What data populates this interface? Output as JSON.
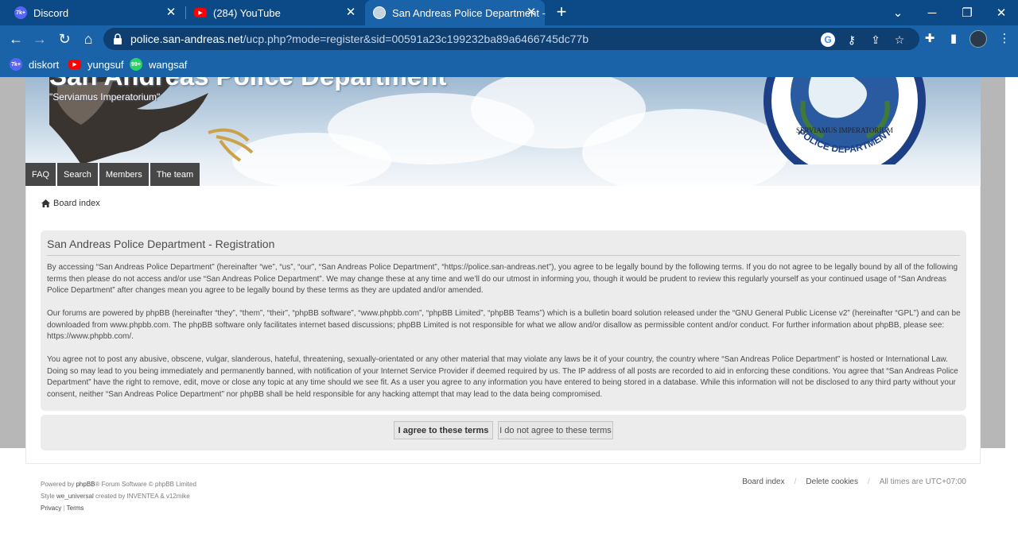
{
  "browser": {
    "tabs": [
      {
        "title": "Discord",
        "favicon_badge": "7k+",
        "favicon_color": "#5865f2"
      },
      {
        "title": "(284) YouTube",
        "favicon_color": "#ff0000"
      },
      {
        "title": "San Andreas Police Department -",
        "favicon_color": "#c5d3e0"
      }
    ],
    "new_tab_icon": "plus-icon",
    "url_host": "police.san-andreas.net",
    "url_path": "/ucp.php?mode=register&sid=00591a23c199232ba89a6466745dc77b",
    "bookmarks": [
      {
        "label": "diskort",
        "favicon_badge": "7k+",
        "favicon_color": "#5865f2"
      },
      {
        "label": "yungsuf",
        "favicon_color": "#ff0000"
      },
      {
        "label": "wangsaf",
        "favicon_badge": "99+",
        "favicon_color": "#25d366"
      }
    ],
    "accent": "#1a63a8",
    "tabstrip_color": "#0b4a86"
  },
  "site": {
    "title": "San Andreas Police Department",
    "description": "\"Serviamus Imperatorium\"",
    "badge_motto": "SERVIAMUS IMPERATORIUM",
    "badge_text": "POLICE DEPARTMENT",
    "nav": [
      "FAQ",
      "Search",
      "Members",
      "The team"
    ],
    "breadcrumb": "Board index"
  },
  "registration": {
    "heading": "San Andreas Police Department - Registration",
    "paragraphs": [
      "By accessing “San Andreas Police Department” (hereinafter “we”, “us”, “our”, “San Andreas Police Department”, “https://police.san-andreas.net”), you agree to be legally bound by the following terms. If you do not agree to be legally bound by all of the following terms then please do not access and/or use “San Andreas Police Department”. We may change these at any time and we’ll do our utmost in informing you, though it would be prudent to review this regularly yourself as your continued usage of “San Andreas Police Department” after changes mean you agree to be legally bound by these terms as they are updated and/or amended.",
      "Our forums are powered by phpBB (hereinafter “they”, “them”, “their”, “phpBB software”, “www.phpbb.com”, “phpBB Limited”, “phpBB Teams”) which is a bulletin board solution released under the “GNU General Public License v2” (hereinafter “GPL”) and can be downloaded from www.phpbb.com. The phpBB software only facilitates internet based discussions; phpBB Limited is not responsible for what we allow and/or disallow as permissible content and/or conduct. For further information about phpBB, please see: https://www.phpbb.com/.",
      "You agree not to post any abusive, obscene, vulgar, slanderous, hateful, threatening, sexually-orientated or any other material that may violate any laws be it of your country, the country where “San Andreas Police Department” is hosted or International Law. Doing so may lead to you being immediately and permanently banned, with notification of your Internet Service Provider if deemed required by us. The IP address of all posts are recorded to aid in enforcing these conditions. You agree that “San Andreas Police Department” have the right to remove, edit, move or close any topic at any time should we see fit. As a user you agree to any information you have entered to being stored in a database. While this information will not be disclosed to any third party without your consent, neither “San Andreas Police Department” nor phpBB shall be held responsible for any hacking attempt that may lead to the data being compromised."
    ],
    "agree_label": "I agree to these terms",
    "disagree_label": "I do not agree to these terms"
  },
  "footer": {
    "powered_prefix": "Powered by",
    "powered_link": "phpBB",
    "powered_suffix": "® Forum Software © phpBB Limited",
    "style_prefix": "Style",
    "style_name": "we_universal",
    "style_suffix": "created by INVENTEA & v12mike",
    "privacy": "Privacy",
    "terms": "Terms",
    "board_index": "Board index",
    "delete_cookies": "Delete cookies",
    "timezone": "All times are UTC+07:00"
  }
}
